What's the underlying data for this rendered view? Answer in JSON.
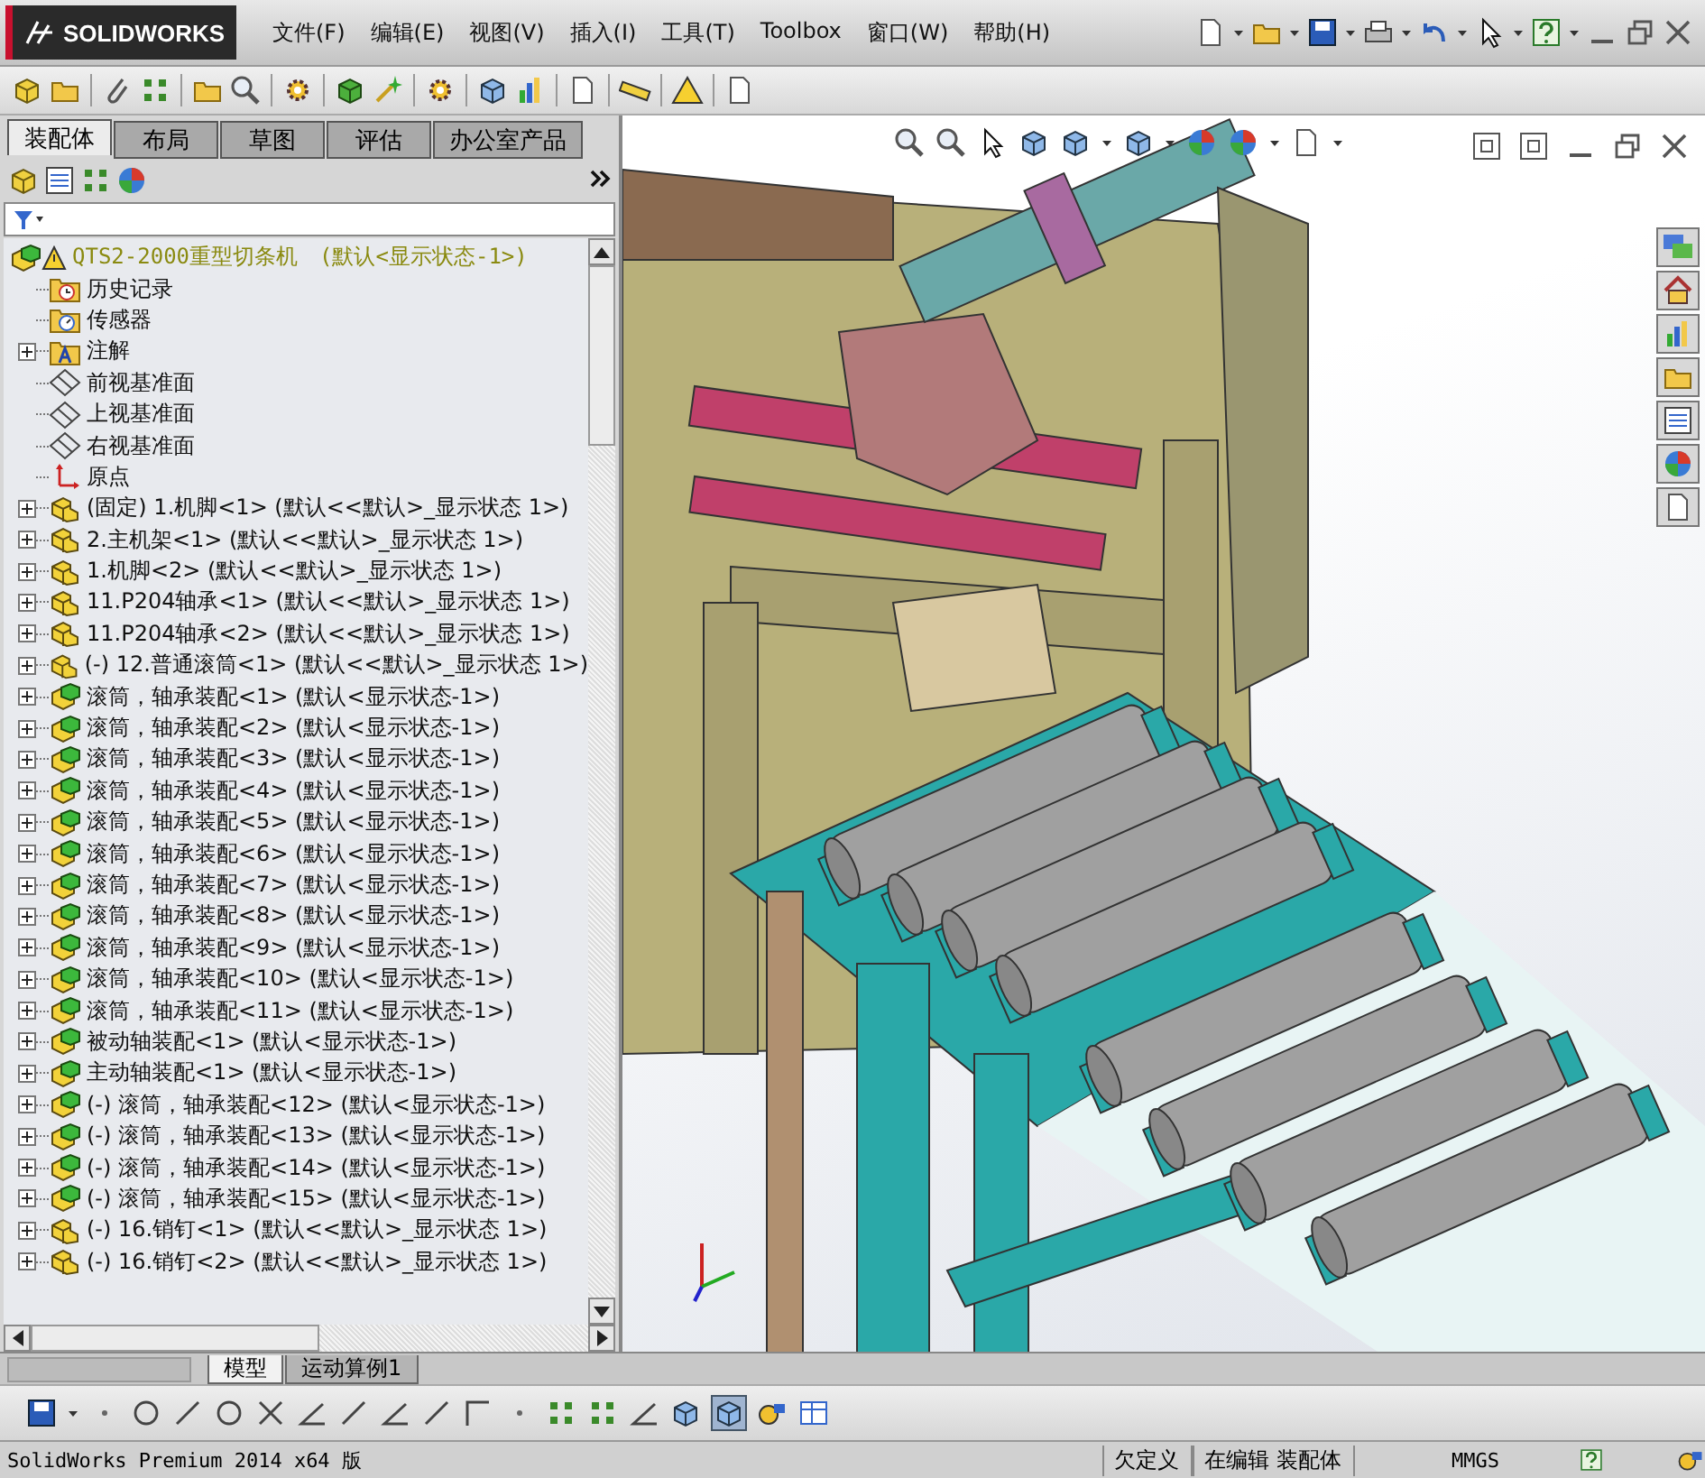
{
  "title_bar": {
    "logo": "SOLIDWORKS",
    "menu": [
      "文件(F)",
      "编辑(E)",
      "视图(V)",
      "插入(I)",
      "工具(T)",
      "Toolbox",
      "窗口(W)",
      "帮助(H)"
    ]
  },
  "panel_tabs": [
    {
      "label": "装配体",
      "selected": true
    },
    {
      "label": "布局",
      "selected": false
    },
    {
      "label": "草图",
      "selected": false
    },
    {
      "label": "评估",
      "selected": false
    },
    {
      "label": "办公室产品",
      "selected": false
    }
  ],
  "tree": {
    "root": {
      "label": "QTS2-2000重型切条机　(默认<显示状态-1>)",
      "warning": true
    },
    "items": [
      {
        "label": "历史记录",
        "kind": "history",
        "expandable": false
      },
      {
        "label": "传感器",
        "kind": "sensor",
        "expandable": false
      },
      {
        "label": "注解",
        "kind": "annotation",
        "expandable": true
      },
      {
        "label": "前视基准面",
        "kind": "plane",
        "expandable": false
      },
      {
        "label": "上视基准面",
        "kind": "plane",
        "expandable": false
      },
      {
        "label": "右视基准面",
        "kind": "plane",
        "expandable": false
      },
      {
        "label": "原点",
        "kind": "origin",
        "expandable": false
      },
      {
        "label": "(固定) 1.机脚<1> (默认<<默认>_显示状态 1>)",
        "kind": "part",
        "expandable": true
      },
      {
        "label": "2.主机架<1> (默认<<默认>_显示状态 1>)",
        "kind": "part",
        "expandable": true
      },
      {
        "label": "1.机脚<2> (默认<<默认>_显示状态 1>)",
        "kind": "part",
        "expandable": true
      },
      {
        "label": "11.P204轴承<1> (默认<<默认>_显示状态 1>)",
        "kind": "part",
        "expandable": true
      },
      {
        "label": "11.P204轴承<2> (默认<<默认>_显示状态 1>)",
        "kind": "part",
        "expandable": true
      },
      {
        "label": "(-) 12.普通滚筒<1> (默认<<默认>_显示状态 1>)",
        "kind": "part",
        "expandable": true
      },
      {
        "label": "滚筒，轴承装配<1> (默认<显示状态-1>)",
        "kind": "assembly",
        "expandable": true
      },
      {
        "label": "滚筒，轴承装配<2> (默认<显示状态-1>)",
        "kind": "assembly",
        "expandable": true
      },
      {
        "label": "滚筒，轴承装配<3> (默认<显示状态-1>)",
        "kind": "assembly",
        "expandable": true
      },
      {
        "label": "滚筒，轴承装配<4> (默认<显示状态-1>)",
        "kind": "assembly",
        "expandable": true
      },
      {
        "label": "滚筒，轴承装配<5> (默认<显示状态-1>)",
        "kind": "assembly",
        "expandable": true
      },
      {
        "label": "滚筒，轴承装配<6> (默认<显示状态-1>)",
        "kind": "assembly",
        "expandable": true
      },
      {
        "label": "滚筒，轴承装配<7> (默认<显示状态-1>)",
        "kind": "assembly",
        "expandable": true
      },
      {
        "label": "滚筒，轴承装配<8> (默认<显示状态-1>)",
        "kind": "assembly",
        "expandable": true
      },
      {
        "label": "滚筒，轴承装配<9> (默认<显示状态-1>)",
        "kind": "assembly",
        "expandable": true
      },
      {
        "label": "滚筒，轴承装配<10> (默认<显示状态-1>)",
        "kind": "assembly",
        "expandable": true
      },
      {
        "label": "滚筒，轴承装配<11> (默认<显示状态-1>)",
        "kind": "assembly",
        "expandable": true
      },
      {
        "label": "被动轴装配<1> (默认<显示状态-1>)",
        "kind": "assembly",
        "expandable": true
      },
      {
        "label": "主动轴装配<1> (默认<显示状态-1>)",
        "kind": "assembly",
        "expandable": true
      },
      {
        "label": "(-) 滚筒，轴承装配<12> (默认<显示状态-1>)",
        "kind": "assembly",
        "expandable": true
      },
      {
        "label": "(-) 滚筒，轴承装配<13> (默认<显示状态-1>)",
        "kind": "assembly",
        "expandable": true
      },
      {
        "label": "(-) 滚筒，轴承装配<14> (默认<显示状态-1>)",
        "kind": "assembly",
        "expandable": true
      },
      {
        "label": "(-) 滚筒，轴承装配<15> (默认<显示状态-1>)",
        "kind": "assembly",
        "expandable": true
      },
      {
        "label": "(-) 16.销钉<1> (默认<<默认>_显示状态 1>)",
        "kind": "part",
        "expandable": true
      },
      {
        "label": "(-) 16.销钉<2> (默认<<默认>_显示状态 1>)",
        "kind": "part",
        "expandable": true
      }
    ]
  },
  "bottom_tabs": [
    {
      "label": "模型",
      "selected": true
    },
    {
      "label": "运动算例1",
      "selected": false
    }
  ],
  "status_bar": [
    "SolidWorks Premium 2014 x64 版",
    "欠定义",
    "在编辑 装配体",
    "MMGS"
  ]
}
